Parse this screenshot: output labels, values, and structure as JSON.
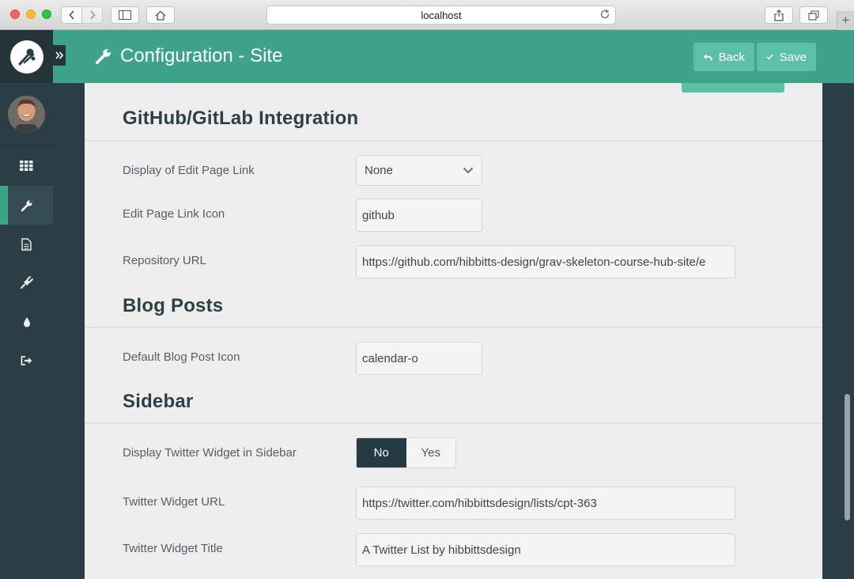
{
  "browser": {
    "url": "localhost"
  },
  "header": {
    "title": "Configuration - Site",
    "back_label": "Back",
    "save_label": "Save"
  },
  "sidebar": {
    "items": [
      {
        "name": "dashboard",
        "icon": "grid-icon"
      },
      {
        "name": "configuration",
        "icon": "wrench-icon",
        "active": true
      },
      {
        "name": "pages",
        "icon": "file-icon"
      },
      {
        "name": "plugins",
        "icon": "plug-icon"
      },
      {
        "name": "themes",
        "icon": "drop-icon"
      },
      {
        "name": "logout",
        "icon": "sign-out-icon"
      }
    ]
  },
  "sections": {
    "github": {
      "title": "GitHub/GitLab Integration",
      "edit_link_label": "Display of Edit Page Link",
      "edit_link_value": "None",
      "edit_icon_label": "Edit Page Link Icon",
      "edit_icon_value": "github",
      "repo_url_label": "Repository URL",
      "repo_url_value": "https://github.com/hibbitts-design/grav-skeleton-course-hub-site/e"
    },
    "blog": {
      "title": "Blog Posts",
      "post_icon_label": "Default Blog Post Icon",
      "post_icon_value": "calendar-o"
    },
    "sidebar": {
      "title": "Sidebar",
      "twitter_label": "Display Twitter Widget in Sidebar",
      "twitter_no": "No",
      "twitter_yes": "Yes",
      "twitter_selected": "No",
      "twitter_url_label": "Twitter Widget URL",
      "twitter_url_value": "https://twitter.com/hibbittsdesign/lists/cpt-363",
      "twitter_title_label": "Twitter Widget Title",
      "twitter_title_value": "A Twitter List by hibbittsdesign"
    }
  },
  "colors": {
    "accent": "#3fa38a",
    "accent_light": "#5bc0a6",
    "sidebar_bg": "#2c3e45",
    "toggle_active": "#253a43"
  }
}
